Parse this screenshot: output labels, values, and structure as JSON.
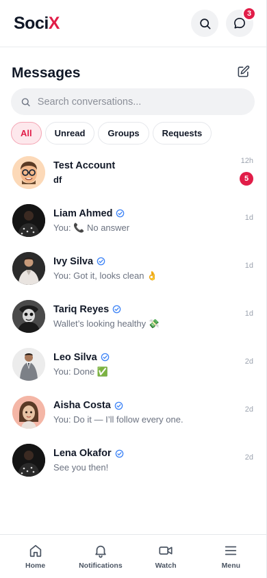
{
  "app": {
    "logo_main": "Soci",
    "logo_accent": "X",
    "notif_count": "3",
    "accent_color": "#e11d48"
  },
  "messages": {
    "title": "Messages",
    "search_placeholder": "Search conversations...",
    "filters": [
      "All",
      "Unread",
      "Groups",
      "Requests"
    ],
    "active_filter": "All",
    "conversations": [
      {
        "name": "Test Account",
        "verified": false,
        "preview": "df",
        "time": "12h",
        "unread": "5"
      },
      {
        "name": "Liam Ahmed",
        "verified": true,
        "preview": "You: 📞 No answer",
        "time": "1d"
      },
      {
        "name": "Ivy Silva",
        "verified": true,
        "preview": "You: Got it, looks clean 👌",
        "time": "1d"
      },
      {
        "name": "Tariq Reyes",
        "verified": true,
        "preview": "Wallet’s looking healthy 💸",
        "time": "1d"
      },
      {
        "name": "Leo Silva",
        "verified": true,
        "preview": "You: Done ✅",
        "time": "2d"
      },
      {
        "name": "Aisha Costa",
        "verified": true,
        "preview": "You: Do it — I’ll follow every one.",
        "time": "2d"
      },
      {
        "name": "Lena Okafor",
        "verified": true,
        "preview": "See you then!",
        "time": "2d"
      }
    ]
  },
  "nav": {
    "home": "Home",
    "notifications": "Notifications",
    "watch": "Watch",
    "menu": "Menu"
  }
}
